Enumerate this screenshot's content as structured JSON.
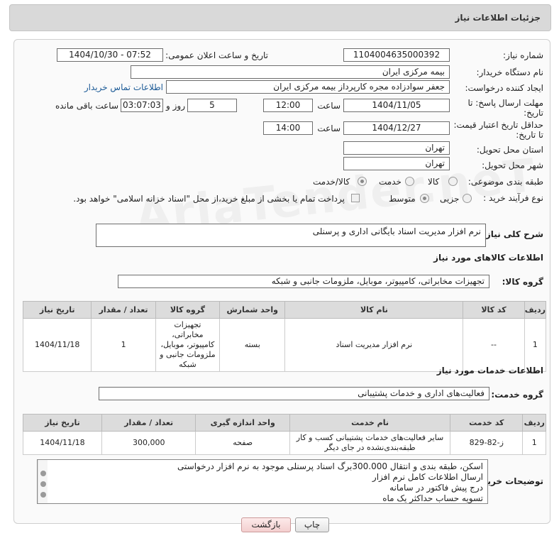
{
  "header": {
    "title": "جزئیات اطلاعات نیاز"
  },
  "watermark": "AriaTender.neT",
  "fields": {
    "need_number_label": "شماره نیاز:",
    "need_number": "1104004635000392",
    "announce_label": "تاریخ و ساعت اعلان عمومی:",
    "announce_value": "1404/10/30 - 07:52",
    "buyer_org_label": "نام دستگاه خریدار:",
    "buyer_org": "بیمه مرکزی ایران",
    "creator_label": "ایجاد کننده درخواست:",
    "creator": "جعفر سوادزاده مجره کارپرداز بیمه مرکزی ایران",
    "contact_link": "اطلاعات تماس خریدار",
    "deadline_label_1": "مهلت ارسال پاسخ: تا",
    "deadline_label_2": "تاریخ:",
    "deadline_date": "1404/11/05",
    "time_word": "ساعت",
    "deadline_time": "12:00",
    "days_value": "5",
    "days_word": "روز و",
    "remaining_time": "03:07:03",
    "remaining_label": "ساعت باقی مانده",
    "price_label_1": "حداقل تاریخ اعتبار قیمت:",
    "price_label_2": "تا تاریخ:",
    "price_date": "1404/12/27",
    "price_time": "14:00",
    "province_label": "استان محل تحویل:",
    "province": "تهران",
    "city_label": "شهر محل تحویل:",
    "city": "تهران",
    "category_label": "طبقه بندی موضوعی:",
    "category_options": [
      "کالا",
      "خدمت",
      "کالا/خدمت"
    ],
    "process_label": "نوع فرآیند خرید :",
    "process_options": [
      "جزیی",
      "متوسط"
    ],
    "payment_note": "پرداخت تمام یا بخشی از مبلغ خرید،از محل \"اسناد خزانه اسلامی\" خواهد بود."
  },
  "description": {
    "label": "شرح کلی نیاز:",
    "value": "نرم افزار مدیریت اسناد بایگانی اداری و پرسنلی"
  },
  "goods": {
    "section_title": "اطلاعات کالاهای مورد نیاز",
    "group_label": "گروه کالا:",
    "group_value": "تجهیزات مخابراتی، کامپیوتر، موبایل، ملزومات جانبی و شبکه",
    "columns": [
      "ردیف",
      "کد کالا",
      "نام کالا",
      "واحد شمارش",
      "گروه کالا",
      "تعداد / مقدار",
      "تاریخ نیاز"
    ],
    "rows": [
      [
        "1",
        "--",
        "نرم افزار مدیریت اسناد",
        "بسته",
        "تجهیزات مخابراتی، کامپیوتر، موبایل، ملزومات جانبی و شبکه",
        "1",
        "1404/11/18"
      ]
    ]
  },
  "services": {
    "section_title": "اطلاعات خدمات مورد نیاز",
    "group_label": "گروه خدمت:",
    "group_value": "فعالیت‌های اداری و خدمات پشتیبانی",
    "columns": [
      "ردیف",
      "کد خدمت",
      "نام خدمت",
      "واحد اندازه گیری",
      "تعداد / مقدار",
      "تاریخ نیاز"
    ],
    "rows": [
      [
        "1",
        "ز-82-829",
        "سایر فعالیت‌های خدمات پشتیبانی کسب و کار طبقه‌بندی‌نشده در جای دیگر",
        "صفحه",
        "300,000",
        "1404/11/18"
      ]
    ]
  },
  "buyer_notes": {
    "label": "توضیحات خریدار:",
    "lines": [
      "اسکن، طبقه بندی و  انتقال 300.000برگ اسناد پرسنلی موجود به نرم افزار درخواستی",
      "ارسال اطلاعات کامل نرم افزار",
      "درج پیش فاکتور در سامانه",
      "تسویه حساب حداکثر یک ماه"
    ]
  },
  "buttons": {
    "print": "چاپ",
    "back": "بازگشت"
  }
}
